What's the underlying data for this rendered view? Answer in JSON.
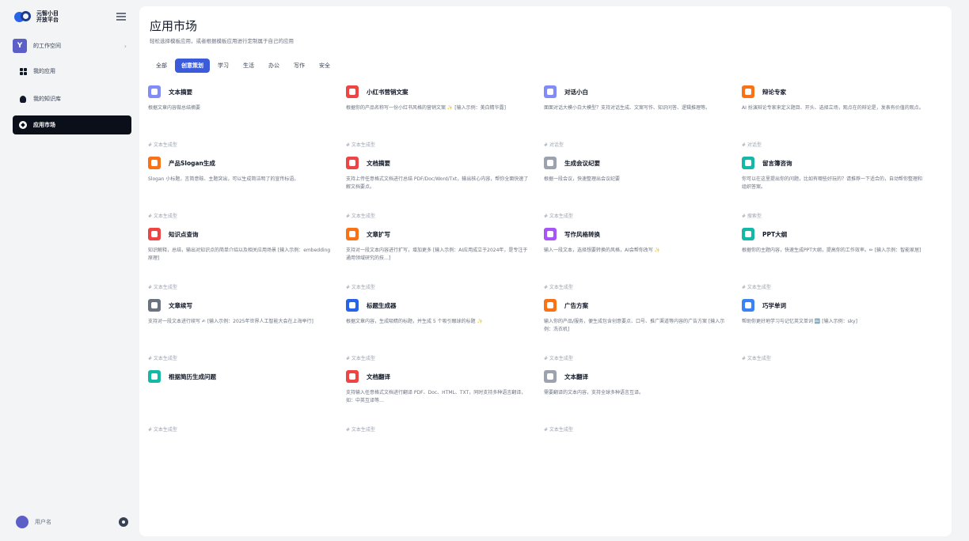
{
  "brand": {
    "line1": "元智小目",
    "line2": "开放平台"
  },
  "workspace": {
    "avatar_letter": "Y",
    "name": "的工作空间"
  },
  "nav": [
    {
      "label": "我的应用",
      "icon": "apps-icon"
    },
    {
      "label": "我的知识库",
      "icon": "knowledge-icon"
    },
    {
      "label": "应用市场",
      "icon": "compass-icon"
    }
  ],
  "user": {
    "name": "用户名"
  },
  "page": {
    "title": "应用市场",
    "subtitle": "轻松选择模板应用，或者根据模板应用进行定制属于自己的应用"
  },
  "tabs": [
    {
      "label": "全部",
      "active": false
    },
    {
      "label": "创意策划",
      "active": true
    },
    {
      "label": "学习",
      "active": false
    },
    {
      "label": "生活",
      "active": false
    },
    {
      "label": "办公",
      "active": false
    },
    {
      "label": "写作",
      "active": false
    },
    {
      "label": "安全",
      "active": false
    }
  ],
  "cards": [
    {
      "name": "文本摘要",
      "desc": "根据文章内容做总结摘要",
      "tag": "# 文本生成型",
      "color": "#818cf8"
    },
    {
      "name": "小红书营销文案",
      "desc": "根据你的产品名称写一份小红书风格的营销文案 ✨ [输入示例：美白精华露]",
      "tag": "# 文本生成型",
      "color": "#ef4444"
    },
    {
      "name": "对话小白",
      "desc": "面面对话大模小白大模型？支持对话生成、文案写作、知识问答、逻辑推理等。",
      "tag": "# 对话型",
      "color": "#818cf8"
    },
    {
      "name": "辩论专家",
      "desc": "AI 扮演辩论专家来定义题目、开头、选择立场，观点在的辩论是，发表有价值的观点。",
      "tag": "# 对话型",
      "color": "#f97316"
    },
    {
      "name": "产品Slogan生成",
      "desc": "Slogan 小标题，言简意赅、主题突出，可以生成简洁明了的宣传标语。",
      "tag": "# 文本生成型",
      "color": "#f97316"
    },
    {
      "name": "文档摘要",
      "desc": "支持上传任意格式文档进行总结 PDF/Doc/Word/Txt，输出核心内容，帮你全面快速了解文档要点。",
      "tag": "# 文本生成型",
      "color": "#ef4444"
    },
    {
      "name": "生成会议纪要",
      "desc": "根据一段会议，快速整理出会议纪要",
      "tag": "# 文本生成型",
      "color": "#9ca3af"
    },
    {
      "name": "留言簿咨询",
      "desc": "你可以在这里提出你的问题，比如有哪些好玩的？请推荐一下适合的，自动帮你整理和组织答案。",
      "tag": "# 搜索型",
      "color": "#14b8a6"
    },
    {
      "name": "知识点查询",
      "desc": "知识解释，总结，输出对知识点的简单介绍以及相关应用场景 [输入示例：embedding原理]",
      "tag": "# 文本生成型",
      "color": "#ef4444"
    },
    {
      "name": "文章扩写",
      "desc": "支持对一段文本内容进行扩写，增加更多 [输入示例：AI应用成立于2024年，是专注于通用领域研究的技…]",
      "tag": "# 文本生成型",
      "color": "#f97316"
    },
    {
      "name": "写作风格转换",
      "desc": "输入一段文本，选择想要转换的风格，AI会帮你改写 ✨",
      "tag": "# 文本生成型",
      "color": "#a855f7"
    },
    {
      "name": "PPT大纲",
      "desc": "根据你的主题内容，快速生成PPT大纲，提高你的工作效率。✏ [输入示例：智能家居]",
      "tag": "# 文本生成型",
      "color": "#14b8a6"
    },
    {
      "name": "文章续写",
      "desc": "支持对一段文本进行续写 ✍ [输入示例：2025年世界人工智能大会在上海举行]",
      "tag": "# 文本生成型",
      "color": "#6b7280"
    },
    {
      "name": "标题生成器",
      "desc": "根据文章内容，生成吸睛的标题，并生成 5 个吸引眼球的标题 ✨",
      "tag": "# 文本生成型",
      "color": "#2563eb"
    },
    {
      "name": "广告方案",
      "desc": "输入你的产品/服务，便生成包含创意要点、口号、推广渠道等内容的广告方案 [输入示例：洗衣机]",
      "tag": "# 文本生成型",
      "color": "#f97316"
    },
    {
      "name": "巧学单词",
      "desc": "帮助你更好地学习与记忆英文单词 🔤 [输入示例：sky]",
      "tag": "# 文本生成型",
      "color": "#3b82f6"
    },
    {
      "name": "根据简历生成问题",
      "desc": "",
      "tag": "# 文本生成型",
      "color": "#14b8a6"
    },
    {
      "name": "文档翻译",
      "desc": "支持输入任意格式文档进行翻译 PDF、Doc、HTML、TXT，同时支持多种语言翻译，如：中英互译等…",
      "tag": "# 文本生成型",
      "color": "#ef4444"
    },
    {
      "name": "文本翻译",
      "desc": "需要翻译的文本内容，支持全球多种语言互译。",
      "tag": "# 文本生成型",
      "color": "#9ca3af"
    }
  ]
}
